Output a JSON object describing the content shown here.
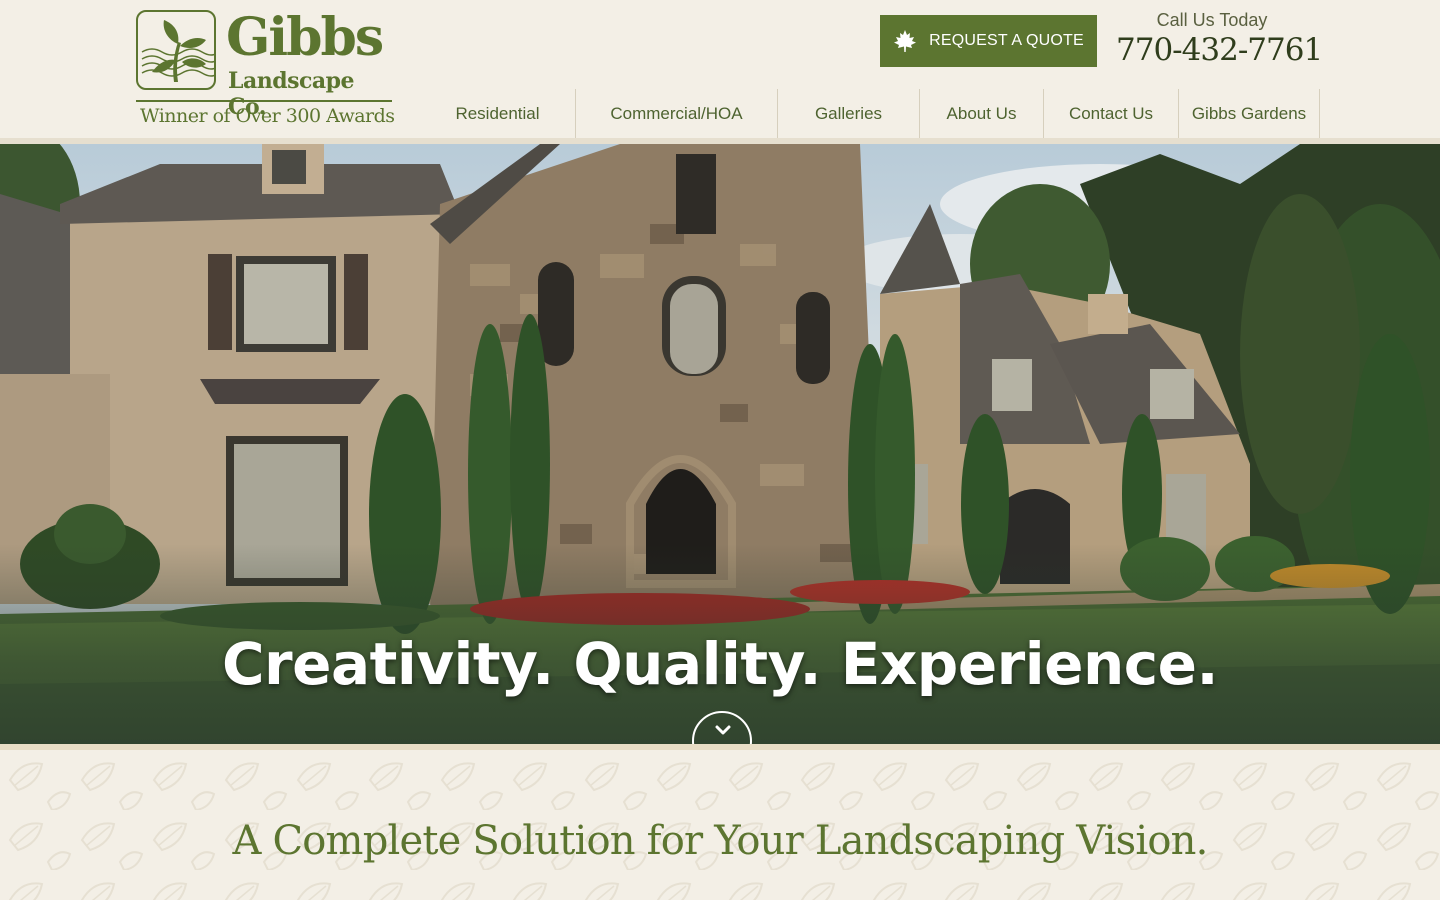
{
  "logo": {
    "name": "Gibbs",
    "sub": "Landscape Co.",
    "tagline": "Winner of Over 300 Awards"
  },
  "header": {
    "quote_button": "REQUEST A QUOTE",
    "call_label": "Call Us Today",
    "phone": "770-432-7761"
  },
  "nav": {
    "items": [
      {
        "label": "Residential"
      },
      {
        "label": "Commercial/HOA"
      },
      {
        "label": "Galleries"
      },
      {
        "label": "About Us"
      },
      {
        "label": "Contact Us"
      },
      {
        "label": "Gibbs Gardens"
      }
    ]
  },
  "hero": {
    "headline": "Creativity. Quality. Experience.",
    "scroll_icon": "chevron-down-icon"
  },
  "section": {
    "title": "A Complete Solution for Your Landscaping Vision."
  },
  "colors": {
    "brand_green": "#5c7530",
    "background": "#f3efe6",
    "phone_text": "#2f3d1c"
  },
  "icons": [
    "maple-leaf-icon",
    "logo-emblem-icon",
    "chevron-down-icon"
  ]
}
